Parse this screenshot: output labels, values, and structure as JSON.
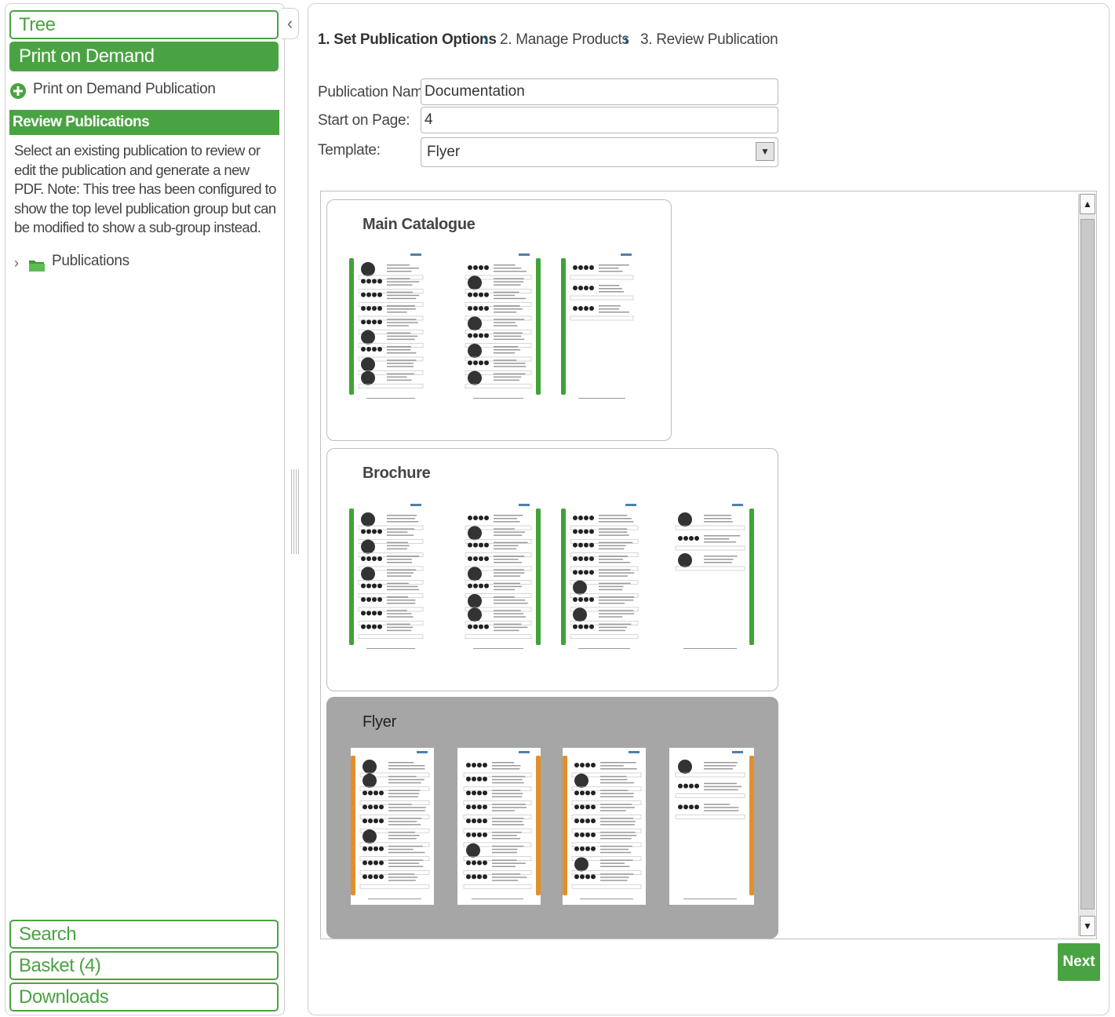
{
  "sidebar": {
    "sections": {
      "tree": "Tree",
      "print_on_demand": "Print on Demand",
      "search": "Search",
      "basket": "Basket (4)",
      "downloads": "Downloads"
    },
    "add_action": "Print on Demand Publication",
    "review_header": "Review Publications",
    "description": "Select an existing publication to review or edit the publication and generate a new PDF. Note: This tree has been configured to show the top level publication group but can be modified to show a sub-group instead.",
    "tree_item": "Publications",
    "colors": {
      "accent": "#4aa342",
      "folder": "#4aa342"
    }
  },
  "wizard": {
    "steps": [
      "1. Set Publication Options",
      "2. Manage Products",
      "3. Review Publication"
    ],
    "separator": "›",
    "active_step": 0
  },
  "form": {
    "publication_name_label": "Publication Name:",
    "publication_name_value": "Documentation",
    "start_page_label": "Start on Page:",
    "start_page_value": "4",
    "template_label": "Template:",
    "template_value": "Flyer"
  },
  "templates": [
    {
      "name": "Main Catalogue",
      "pages": 3,
      "bar_color": "#3fa33a",
      "selected": false
    },
    {
      "name": "Brochure",
      "pages": 4,
      "bar_color": "#3fa33a",
      "selected": false
    },
    {
      "name": "Flyer",
      "pages": 4,
      "bar_color": "#e0902a",
      "selected": true
    }
  ],
  "actions": {
    "next_label": "Next"
  },
  "icons": {
    "add": "plus-circle-icon",
    "expand": "chevron-right-icon",
    "folder": "folder-icon",
    "collapse": "chevron-left-icon",
    "dropdown": "dropdown-arrow-icon",
    "scroll_up": "scroll-up-arrow-icon",
    "scroll_down": "scroll-down-arrow-icon"
  }
}
